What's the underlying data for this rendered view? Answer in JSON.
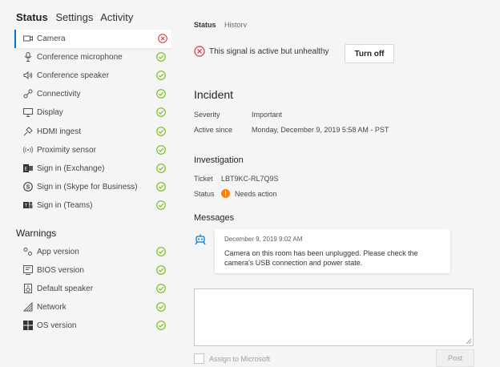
{
  "tabs": [
    "Status",
    "Settings",
    "Activity"
  ],
  "status_items": [
    {
      "label": "Camera",
      "icon": "camera-icon",
      "state": "error"
    },
    {
      "label": "Conference microphone",
      "icon": "microphone-icon",
      "state": "ok"
    },
    {
      "label": "Conference speaker",
      "icon": "speaker-icon",
      "state": "ok"
    },
    {
      "label": "Connectivity",
      "icon": "connectivity-icon",
      "state": "ok"
    },
    {
      "label": "Display",
      "icon": "display-icon",
      "state": "ok"
    },
    {
      "label": "HDMI ingest",
      "icon": "hdmi-icon",
      "state": "ok"
    },
    {
      "label": "Proximity sensor",
      "icon": "proximity-icon",
      "state": "ok"
    },
    {
      "label": "Sign in (Exchange)",
      "icon": "exchange-icon",
      "state": "ok"
    },
    {
      "label": "Sign in (Skype for Business)",
      "icon": "skype-icon",
      "state": "ok"
    },
    {
      "label": "Sign in (Teams)",
      "icon": "teams-icon",
      "state": "ok"
    }
  ],
  "warnings_heading": "Warnings",
  "warning_items": [
    {
      "label": "App version",
      "icon": "app-version-icon",
      "state": "ok"
    },
    {
      "label": "BIOS version",
      "icon": "bios-icon",
      "state": "ok"
    },
    {
      "label": "Default speaker",
      "icon": "default-speaker-icon",
      "state": "ok"
    },
    {
      "label": "Network",
      "icon": "network-icon",
      "state": "ok"
    },
    {
      "label": "OS version",
      "icon": "windows-icon",
      "state": "ok"
    }
  ],
  "detail": {
    "subtabs": [
      "Status",
      "History"
    ],
    "alert_text": "This signal is active but unhealthy",
    "turn_off_label": "Turn off",
    "incident_heading": "Incident",
    "severity_label": "Severity",
    "severity_value": "Important",
    "active_since_label": "Active since",
    "active_since_value": "Monday, December 9, 2019 5:58 AM - PST",
    "investigation_heading": "Investigation",
    "ticket_label": "Ticket",
    "ticket_value": "LBT9KC-RL7Q9S",
    "status_label": "Status",
    "status_value": "Needs action",
    "messages_heading": "Messages",
    "message_date": "December 9, 2019 9:02 AM",
    "message_text": "Camera on this room has been unplugged. Please check the camera's USB connection and power state.",
    "assign_label": "Assign to Microsoft",
    "post_label": "Post"
  },
  "colors": {
    "accent": "#0078d4",
    "error": "#d13438",
    "ok": "#6bb700",
    "warning": "#f7830f"
  }
}
